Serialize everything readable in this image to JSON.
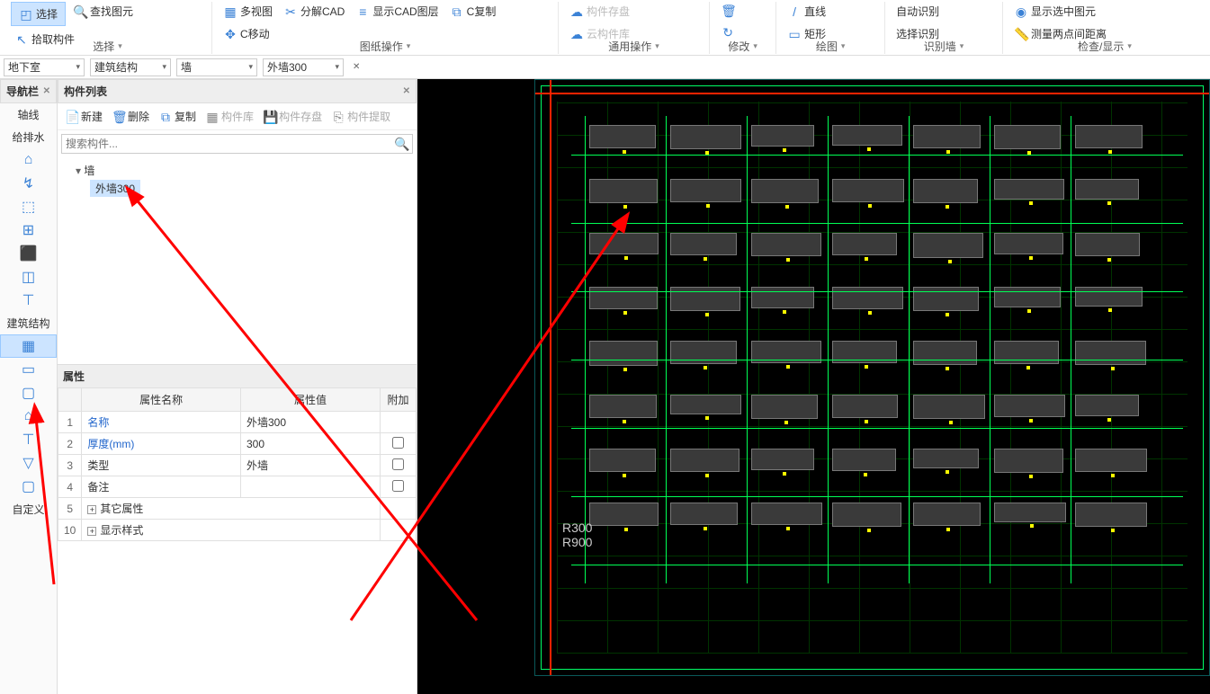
{
  "ribbon": {
    "groups": [
      {
        "label": "选择",
        "items": [
          {
            "name": "select-button",
            "icon": "◰",
            "text": "选择",
            "cls": "select-btn"
          },
          {
            "name": "find-graphic",
            "icon": "🔍",
            "text": "查找图元"
          },
          {
            "name": "pick-component",
            "icon": "↖",
            "text": "拾取构件"
          }
        ]
      },
      {
        "label": "图纸操作",
        "items": [
          {
            "name": "multi-view",
            "icon": "▦",
            "text": "多视图"
          },
          {
            "name": "split-cad",
            "icon": "✂",
            "text": "分解CAD"
          },
          {
            "name": "show-cad-layer",
            "icon": "≡",
            "text": "显示CAD图层"
          },
          {
            "name": "c-copy",
            "icon": "⧉",
            "text": "C复制"
          },
          {
            "name": "c-move",
            "icon": "✥",
            "text": "C移动"
          }
        ]
      },
      {
        "label": "通用操作",
        "items": [
          {
            "name": "component-store",
            "icon": "☁",
            "text": "构件存盘",
            "disabled": true
          },
          {
            "name": "cloud-component-lib",
            "icon": "☁",
            "text": "云构件库",
            "disabled": true
          }
        ]
      },
      {
        "label": "修改",
        "items": [
          {
            "name": "delete",
            "icon": "🗑",
            "text": ""
          },
          {
            "name": "rotate",
            "icon": "↻",
            "text": ""
          }
        ]
      },
      {
        "label": "绘图",
        "items": [
          {
            "name": "line",
            "icon": "/",
            "text": "直线"
          },
          {
            "name": "rect",
            "icon": "▭",
            "text": "矩形"
          }
        ]
      },
      {
        "label": "识别墙",
        "items": [
          {
            "name": "auto-recognize",
            "icon": "",
            "text": "自动识别"
          },
          {
            "name": "select-recognize",
            "icon": "",
            "text": "选择识别"
          }
        ]
      },
      {
        "label": "检查/显示",
        "items": [
          {
            "name": "show-selected",
            "icon": "◉",
            "text": "显示选中图元"
          },
          {
            "name": "measure-distance",
            "icon": "📏",
            "text": "测量两点间距离"
          }
        ]
      }
    ]
  },
  "filters": {
    "floor": "地下室",
    "category": "建筑结构",
    "type": "墙",
    "component": "外墙300"
  },
  "navPanel": {
    "title": "导航栏"
  },
  "navSections": [
    {
      "label": "轴线"
    },
    {
      "label": "给排水",
      "icons": [
        "⌂",
        "↯",
        "⬚",
        "⊞",
        "⬛",
        "◫",
        "⊤"
      ]
    },
    {
      "label": "建筑结构",
      "icons": [
        "▦",
        "▭",
        "▢",
        "⌂",
        "⊤",
        "▽",
        "▢"
      ],
      "selectedIdx": 0
    },
    {
      "label": "自定义"
    }
  ],
  "componentList": {
    "title": "构件列表",
    "toolbar": [
      {
        "name": "new",
        "icon": "📄",
        "text": "新建"
      },
      {
        "name": "delete",
        "icon": "🗑",
        "text": "删除"
      },
      {
        "name": "copy",
        "icon": "⧉",
        "text": "复制"
      },
      {
        "name": "component-lib",
        "icon": "▦",
        "text": "构件库",
        "disabled": true
      },
      {
        "name": "component-save",
        "icon": "💾",
        "text": "构件存盘",
        "disabled": true
      },
      {
        "name": "component-extract",
        "icon": "⎘",
        "text": "构件提取",
        "disabled": true
      }
    ],
    "searchPlaceholder": "搜索构件...",
    "tree": {
      "root": "墙",
      "children": [
        "外墙300"
      ]
    }
  },
  "properties": {
    "title": "属性",
    "columns": [
      "属性名称",
      "属性值",
      "附加"
    ],
    "rows": [
      {
        "n": "1",
        "name": "名称",
        "value": "外墙300",
        "link": true,
        "chk": false
      },
      {
        "n": "2",
        "name": "厚度(mm)",
        "value": "300",
        "link": true,
        "chk": true
      },
      {
        "n": "3",
        "name": "类型",
        "value": "外墙",
        "link": false,
        "chk": true
      },
      {
        "n": "4",
        "name": "备注",
        "value": "",
        "link": false,
        "chk": true
      },
      {
        "n": "5",
        "name": "其它属性",
        "value": "",
        "expand": true
      },
      {
        "n": "10",
        "name": "显示样式",
        "value": "",
        "expand": true
      }
    ]
  }
}
